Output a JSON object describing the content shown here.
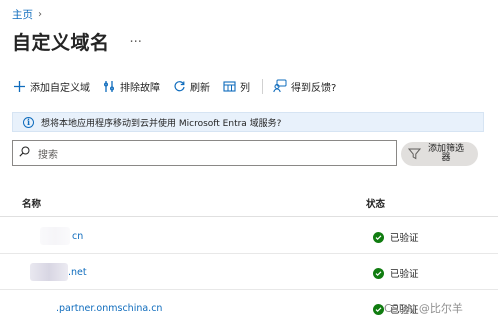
{
  "breadcrumb": {
    "home": "主页"
  },
  "header": {
    "title": "自定义域名",
    "more": "···"
  },
  "toolbar": {
    "add": "添加自定义域",
    "troubleshoot": "排除故障",
    "refresh": "刷新",
    "columns": "列",
    "feedback": "得到反馈?"
  },
  "info_bar": {
    "text": "想将本地应用程序移动到云并使用 Microsoft Entra 域服务?"
  },
  "search": {
    "placeholder": "搜索"
  },
  "filter": {
    "label": "添加筛选器"
  },
  "table": {
    "columns": [
      "名称",
      "状态"
    ],
    "rows": [
      {
        "name": "cn",
        "status": "已验证"
      },
      {
        "name": ".net",
        "status": "已验证"
      },
      {
        "name": ".partner.onmschina.cn",
        "status": "已验证"
      }
    ]
  },
  "watermark": "CSDN @比尔羊",
  "colors": {
    "accent": "#0f6cbd",
    "verified": "#107c10",
    "info_bg": "#e8f1fb"
  }
}
